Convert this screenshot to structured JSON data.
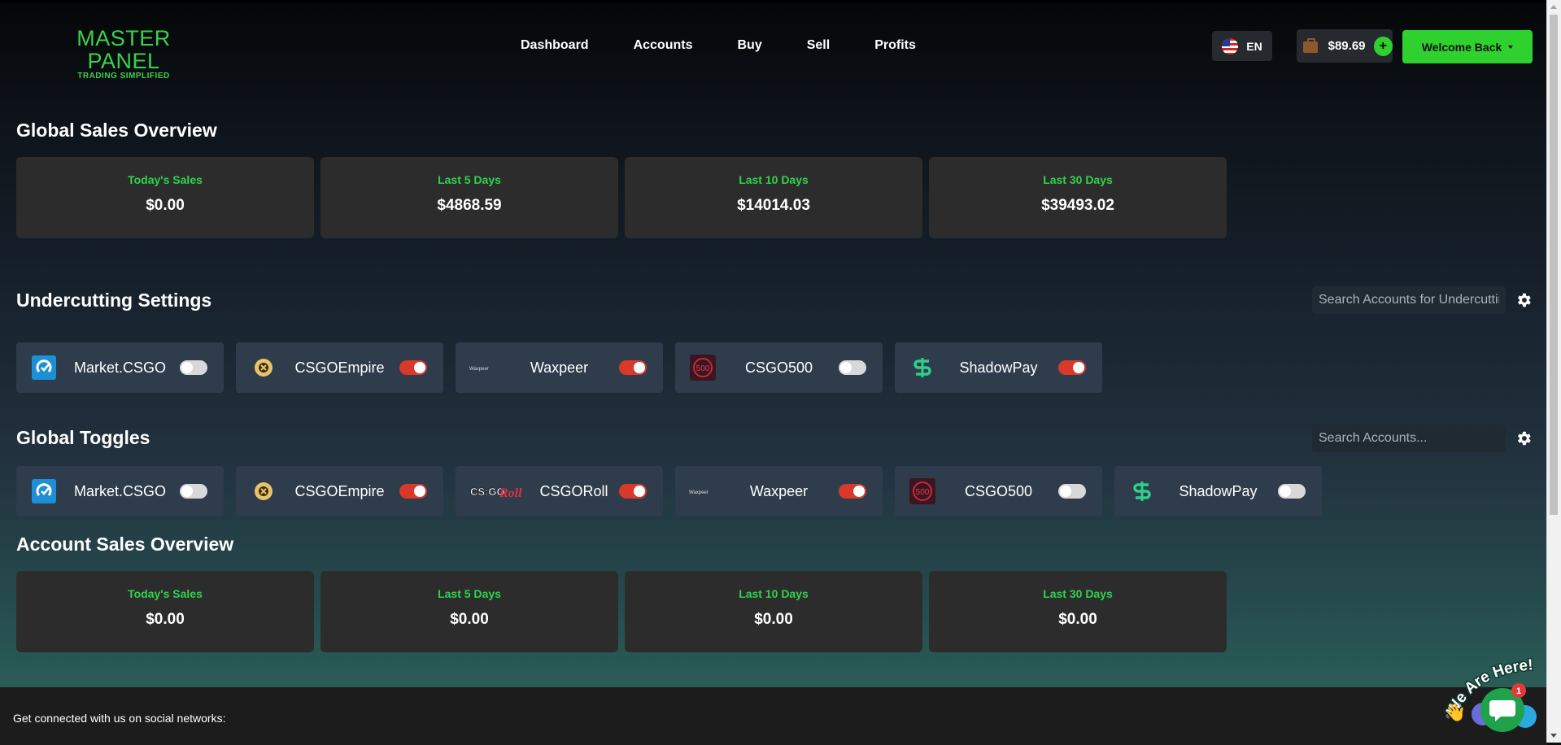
{
  "brand": {
    "name": "MASTER PANEL",
    "tagline": "TRADING SIMPLIFIED"
  },
  "nav": [
    "Dashboard",
    "Accounts",
    "Buy",
    "Sell",
    "Profits"
  ],
  "language": "EN",
  "wallet": {
    "balance": "$89.69",
    "add_label": "+"
  },
  "user_menu": "Welcome Back",
  "global_sales": {
    "title": "Global Sales Overview",
    "cards": [
      {
        "label": "Today's Sales",
        "value": "$0.00"
      },
      {
        "label": "Last 5 Days",
        "value": "$4868.59"
      },
      {
        "label": "Last 10 Days",
        "value": "$14014.03"
      },
      {
        "label": "Last 30 Days",
        "value": "$39493.02"
      }
    ]
  },
  "undercutting": {
    "title": "Undercutting Settings",
    "search_placeholder": "Search Accounts for Undercutting",
    "items": [
      {
        "name": "Market.CSGO",
        "logo": "market-csgo-logo",
        "enabled": false
      },
      {
        "name": "CSGOEmpire",
        "logo": "csgoempire-logo",
        "enabled": true
      },
      {
        "name": "Waxpeer",
        "logo": "waxpeer-logo",
        "enabled": true
      },
      {
        "name": "CSGO500",
        "logo": "csgo500-logo",
        "enabled": false
      },
      {
        "name": "ShadowPay",
        "logo": "shadowpay-logo",
        "enabled": true
      }
    ]
  },
  "global_toggles": {
    "title": "Global Toggles",
    "search_placeholder": "Search Accounts...",
    "items": [
      {
        "name": "Market.CSGO",
        "logo": "market-csgo-logo",
        "enabled": false
      },
      {
        "name": "CSGOEmpire",
        "logo": "csgoempire-logo",
        "enabled": true
      },
      {
        "name": "CSGORoll",
        "logo": "csgoroll-logo",
        "enabled": true
      },
      {
        "name": "Waxpeer",
        "logo": "waxpeer-logo",
        "enabled": true
      },
      {
        "name": "CSGO500",
        "logo": "csgo500-logo",
        "enabled": false
      },
      {
        "name": "ShadowPay",
        "logo": "shadowpay-logo",
        "enabled": false
      }
    ]
  },
  "account_sales": {
    "title": "Account Sales Overview",
    "cards": [
      {
        "label": "Today's Sales",
        "value": "$0.00"
      },
      {
        "label": "Last 5 Days",
        "value": "$0.00"
      },
      {
        "label": "Last 10 Days",
        "value": "$0.00"
      },
      {
        "label": "Last 30 Days",
        "value": "$0.00"
      }
    ]
  },
  "footer": {
    "social_text": "Get connected with us on social networks:"
  },
  "chat": {
    "banner": "We Are Here!",
    "badge_count": "1"
  },
  "logo_text": {
    "waxpeer": "Waxpeer",
    "csgo500": "500",
    "csgoroll_a": "CS:GO",
    "csgoroll_b": "Roll"
  },
  "colors": {
    "accent_green": "#2ed12e",
    "toggle_on": "#d8392b",
    "card_bg": "#2c2c2c",
    "chip_bg": "#2e3c4c"
  }
}
